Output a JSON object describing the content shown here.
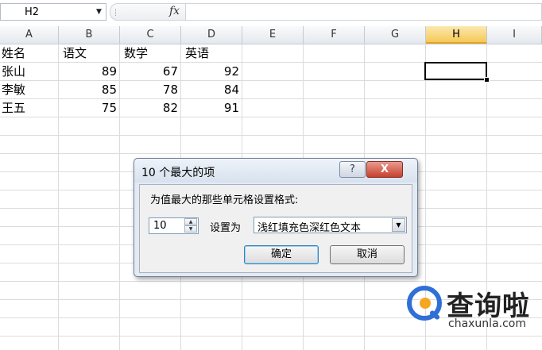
{
  "name_box": {
    "value": "H2"
  },
  "formula_bar": {
    "fx_label": "fx",
    "value": ""
  },
  "columns": [
    "A",
    "B",
    "C",
    "D",
    "E",
    "F",
    "G",
    "H",
    "I"
  ],
  "active_column": "H",
  "selected_cell": "H2",
  "sheet": {
    "headers": [
      "姓名",
      "语文",
      "数学",
      "英语"
    ],
    "rows": [
      [
        "张山",
        "89",
        "67",
        "92"
      ],
      [
        "李敏",
        "85",
        "78",
        "84"
      ],
      [
        "王五",
        "75",
        "82",
        "91"
      ]
    ]
  },
  "dialog": {
    "title": "10 个最大的项",
    "help_label": "?",
    "close_label": "X",
    "prompt": "为值最大的那些单元格设置格式:",
    "count_value": "10",
    "format_label": "设置为",
    "format_value": "浅红填充色深红色文本",
    "ok_label": "确定",
    "cancel_label": "取消"
  },
  "watermark": {
    "brand": "查询啦",
    "domain": "chaxunla.com"
  },
  "colors": {
    "accent": "#f5c957",
    "close": "#c6412f",
    "logo_blue": "#2f6fd6",
    "logo_orange": "#f5a623"
  }
}
